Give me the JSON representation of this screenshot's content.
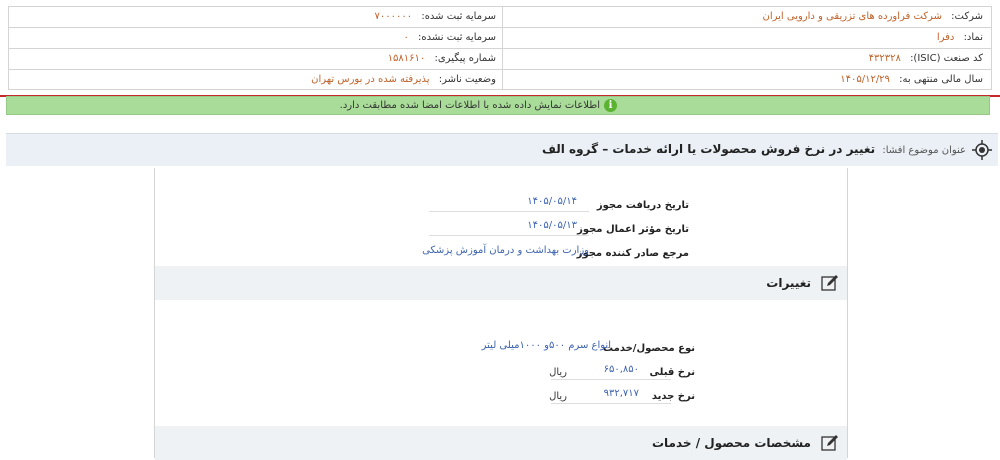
{
  "company_info": {
    "company_label": "شرکت:",
    "company_value": "شرکت فراورده های تزریقی و دارویی ایران",
    "symbol_label": "نماد:",
    "symbol_value": "دفرا",
    "isic_label": "کد صنعت (ISIC):",
    "isic_value": "۴۳۲۳۲۸",
    "fiscal_label": "سال مالی منتهی به:",
    "fiscal_value": "۱۴۰۵/۱۲/۲۹",
    "registered_capital_label": "سرمایه ثبت شده:",
    "registered_capital_value": "۷۰۰۰۰۰۰",
    "unregistered_capital_label": "سرمایه ثبت نشده:",
    "unregistered_capital_value": "۰",
    "tracking_label": "شماره پیگیری:",
    "tracking_value": "۱۵۸۱۶۱۰",
    "status_label": "وضعیت ناشر:",
    "status_value": "پذیرفته شده در بورس تهران"
  },
  "notice": {
    "text": "اطلاعات نمایش داده شده با اطلاعات امضا شده مطابقت دارد.",
    "icon": "info-icon",
    "color": "#a9dc98"
  },
  "subject": {
    "label": "عنوان موضوع افشا:",
    "value": "تغییر در نرخ فروش محصولات یا ارائه خدمات – گروه الف"
  },
  "license": {
    "receive_date_label": "تاریخ دریافت مجوز",
    "receive_date_value": "۱۴۰۵/۰۵/۱۴",
    "effective_date_label": "تاریخ مؤثر اعمال مجوز",
    "effective_date_value": "۱۴۰۵/۰۵/۱۳",
    "issuer_label": "مرجع صادر کننده مجوز",
    "issuer_value": "وزارت بهداشت و درمان آموزش پزشکی"
  },
  "changes": {
    "title": "تغییرات",
    "product_label": "نوع محصول/خدمت",
    "product_value": "انواع سرم ۵۰۰و ۱۰۰۰میلی لیتر",
    "old_rate_label": "نرخ قبلی",
    "old_rate_value": "۶۵۰,۸۵۰",
    "old_rate_unit": "ریال",
    "new_rate_label": "نرخ جدید",
    "new_rate_value": "۹۳۲,۷۱۷",
    "new_rate_unit": "ریال"
  },
  "specs": {
    "title": "مشخصات محصول / خدمات"
  }
}
